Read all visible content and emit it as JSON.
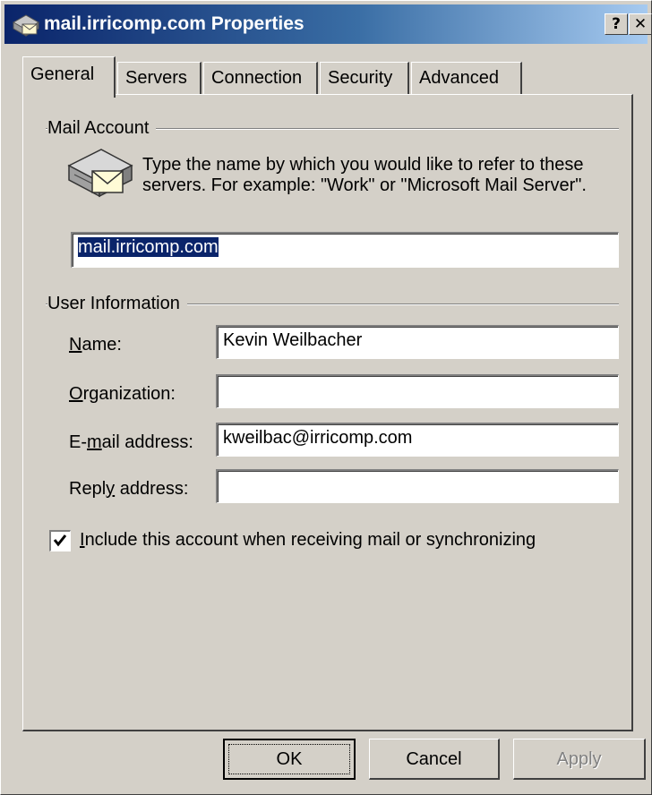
{
  "window": {
    "title": "mail.irricomp.com Properties",
    "help_button": "?",
    "close_button": "✕"
  },
  "tabs": [
    {
      "label": "General",
      "active": true
    },
    {
      "label": "Servers",
      "active": false
    },
    {
      "label": "Connection",
      "active": false
    },
    {
      "label": "Security",
      "active": false
    },
    {
      "label": "Advanced",
      "active": false
    }
  ],
  "mail_account": {
    "group_label": "Mail Account",
    "description": "Type the name by which you would like to refer to these servers.  For example: \"Work\" or \"Microsoft Mail Server\".",
    "account_name": "mail.irricomp.com"
  },
  "user_information": {
    "group_label": "User Information",
    "name": {
      "label_pre": "",
      "label_ul": "N",
      "label_post": "ame:",
      "value": "Kevin Weilbacher"
    },
    "organization": {
      "label_pre": "",
      "label_ul": "O",
      "label_post": "rganization:",
      "value": ""
    },
    "email": {
      "label_pre": "E-",
      "label_ul": "m",
      "label_post": "ail address:",
      "value": "kweilbac@irricomp.com"
    },
    "reply": {
      "label_pre": "Repl",
      "label_ul": "y",
      "label_post": " address:",
      "value": ""
    }
  },
  "include_account": {
    "checked": true,
    "label_ul": "I",
    "label_rest": "nclude this account when receiving mail or synchronizing"
  },
  "buttons": {
    "ok": "OK",
    "cancel": "Cancel",
    "apply": "Apply",
    "apply_enabled": false
  },
  "colors": {
    "titlebar_start": "#0a246a",
    "titlebar_end": "#a6caf0",
    "face": "#d4d0c8",
    "selection": "#0a246a"
  }
}
